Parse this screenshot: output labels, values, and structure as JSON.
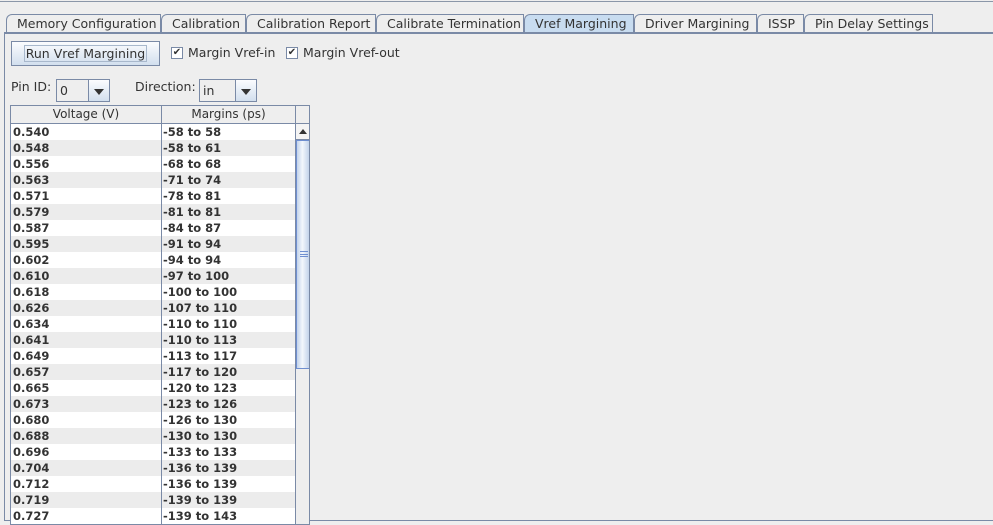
{
  "tabs": [
    {
      "label": "Memory Configuration"
    },
    {
      "label": "Calibration"
    },
    {
      "label": "Calibration Report"
    },
    {
      "label": "Calibrate Termination"
    },
    {
      "label": "Vref Margining",
      "selected": true
    },
    {
      "label": "Driver Margining"
    },
    {
      "label": "ISSP"
    },
    {
      "label": "Pin Delay Settings"
    }
  ],
  "controls": {
    "run_button": "Run Vref Margining",
    "margin_vref_in": {
      "label": "Margin Vref-in",
      "checked": true,
      "mark": "✔"
    },
    "margin_vref_out": {
      "label": "Margin Vref-out",
      "checked": true,
      "mark": "✔"
    },
    "pin_id": {
      "label": "Pin ID:",
      "value": "0"
    },
    "direction": {
      "label": "Direction:",
      "value": "in"
    }
  },
  "table": {
    "headers": [
      "Voltage (V)",
      "Margins (ps)"
    ],
    "rows": [
      [
        "0.540",
        "-58 to 58"
      ],
      [
        "0.548",
        "-58 to 61"
      ],
      [
        "0.556",
        "-68 to 68"
      ],
      [
        "0.563",
        "-71 to 74"
      ],
      [
        "0.571",
        "-78 to 81"
      ],
      [
        "0.579",
        "-81 to 81"
      ],
      [
        "0.587",
        "-84 to 87"
      ],
      [
        "0.595",
        "-91 to 94"
      ],
      [
        "0.602",
        "-94 to 94"
      ],
      [
        "0.610",
        "-97 to 100"
      ],
      [
        "0.618",
        "-100 to 100"
      ],
      [
        "0.626",
        "-107 to 110"
      ],
      [
        "0.634",
        "-110 to 110"
      ],
      [
        "0.641",
        "-110 to 113"
      ],
      [
        "0.649",
        "-113 to 117"
      ],
      [
        "0.657",
        "-117 to 120"
      ],
      [
        "0.665",
        "-120 to 123"
      ],
      [
        "0.673",
        "-123 to 126"
      ],
      [
        "0.680",
        "-126 to 130"
      ],
      [
        "0.688",
        "-130 to 130"
      ],
      [
        "0.696",
        "-133 to 133"
      ],
      [
        "0.704",
        "-136 to 139"
      ],
      [
        "0.712",
        "-136 to 139"
      ],
      [
        "0.719",
        "-139 to 139"
      ],
      [
        "0.727",
        "-139 to 143"
      ]
    ]
  }
}
